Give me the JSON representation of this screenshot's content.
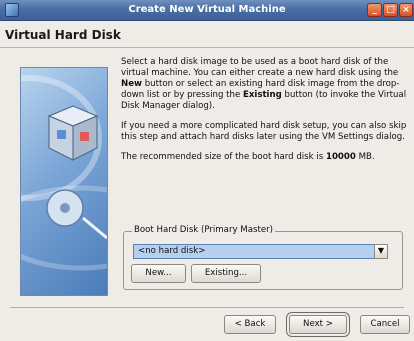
{
  "window": {
    "title": "Create New Virtual Machine"
  },
  "header": {
    "heading": "Virtual Hard Disk"
  },
  "content": {
    "p1_a": "Select a hard disk image to be used as a boot hard disk of the virtual machine. You can either create a new hard disk using the ",
    "p1_b": "New",
    "p1_c": " button or select an existing hard disk image from the drop-down list or by pressing the ",
    "p1_d": "Existing",
    "p1_e": " button (to invoke the Virtual Disk Manager dialog).",
    "p2": "If you need a more complicated hard disk setup, you can also skip this step and attach hard disks later using the VM Settings dialog.",
    "p3_a": "The recommended size of the boot hard disk is ",
    "p3_b": "10000",
    "p3_c": " MB."
  },
  "groupbox": {
    "label": "Boot Hard Disk (Primary Master)",
    "combo_value": "<no hard disk>",
    "new_label": "New...",
    "existing_label": "Existing..."
  },
  "footer": {
    "back_label": "< Back",
    "next_label": "Next >",
    "cancel_label": "Cancel"
  },
  "icons": {
    "titlebar": "virtualbox-icon",
    "illustration": "virtualbox-cube-icon"
  }
}
